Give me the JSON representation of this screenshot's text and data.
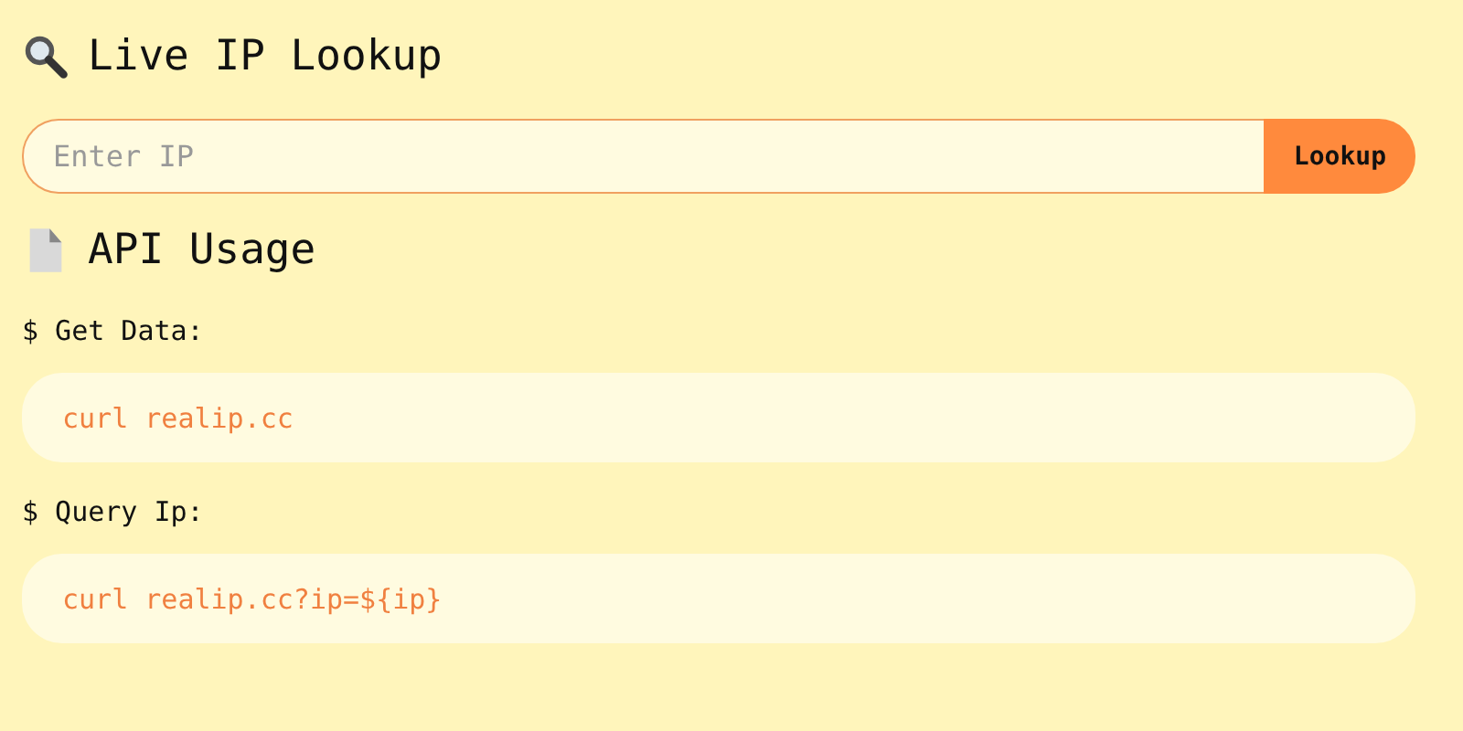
{
  "lookup": {
    "title": "Live IP Lookup",
    "input": {
      "placeholder": "Enter IP"
    },
    "button": "Lookup"
  },
  "usage": {
    "title": "API Usage",
    "examples": [
      {
        "label": "$ Get Data:",
        "code": "curl realip.cc"
      },
      {
        "label": "$ Query Ip:",
        "code": "curl realip.cc?ip=${ip}"
      }
    ]
  }
}
